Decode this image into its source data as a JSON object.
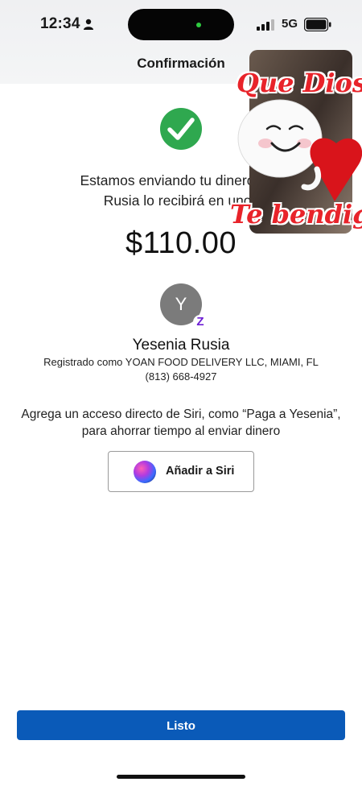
{
  "status_bar": {
    "time": "12:34",
    "network": "5G",
    "icons": [
      "person-icon",
      "signal-bars-icon",
      "battery-icon"
    ]
  },
  "nav": {
    "title": "Confirmación"
  },
  "confirmation": {
    "icon": "checkmark-icon",
    "success_color": "#2fa84f",
    "message_line1": "Estamos enviando tu dinero aho",
    "message_line2": "Rusia lo recibirá en unos",
    "amount": "$110.00"
  },
  "recipient": {
    "initial": "Y",
    "badge": "Z",
    "name": "Yesenia Rusia",
    "registered": "Registrado como YOAN FOOD DELIVERY LLC, MIAMI, FL",
    "phone": "(813) 668-4927"
  },
  "siri": {
    "prompt_line1": "Agrega un acceso directo de Siri, como “Paga a Yesenia”,",
    "prompt_line2": "para ahorrar tiempo al enviar dinero",
    "button_label": "Añadir a Siri",
    "icon": "siri-icon"
  },
  "sticker": {
    "text_top": "Que Dios",
    "text_bottom": "Te bendig",
    "accent": "#e8232a"
  },
  "footer": {
    "done_label": "Listo",
    "button_color": "#0a5ab8"
  }
}
